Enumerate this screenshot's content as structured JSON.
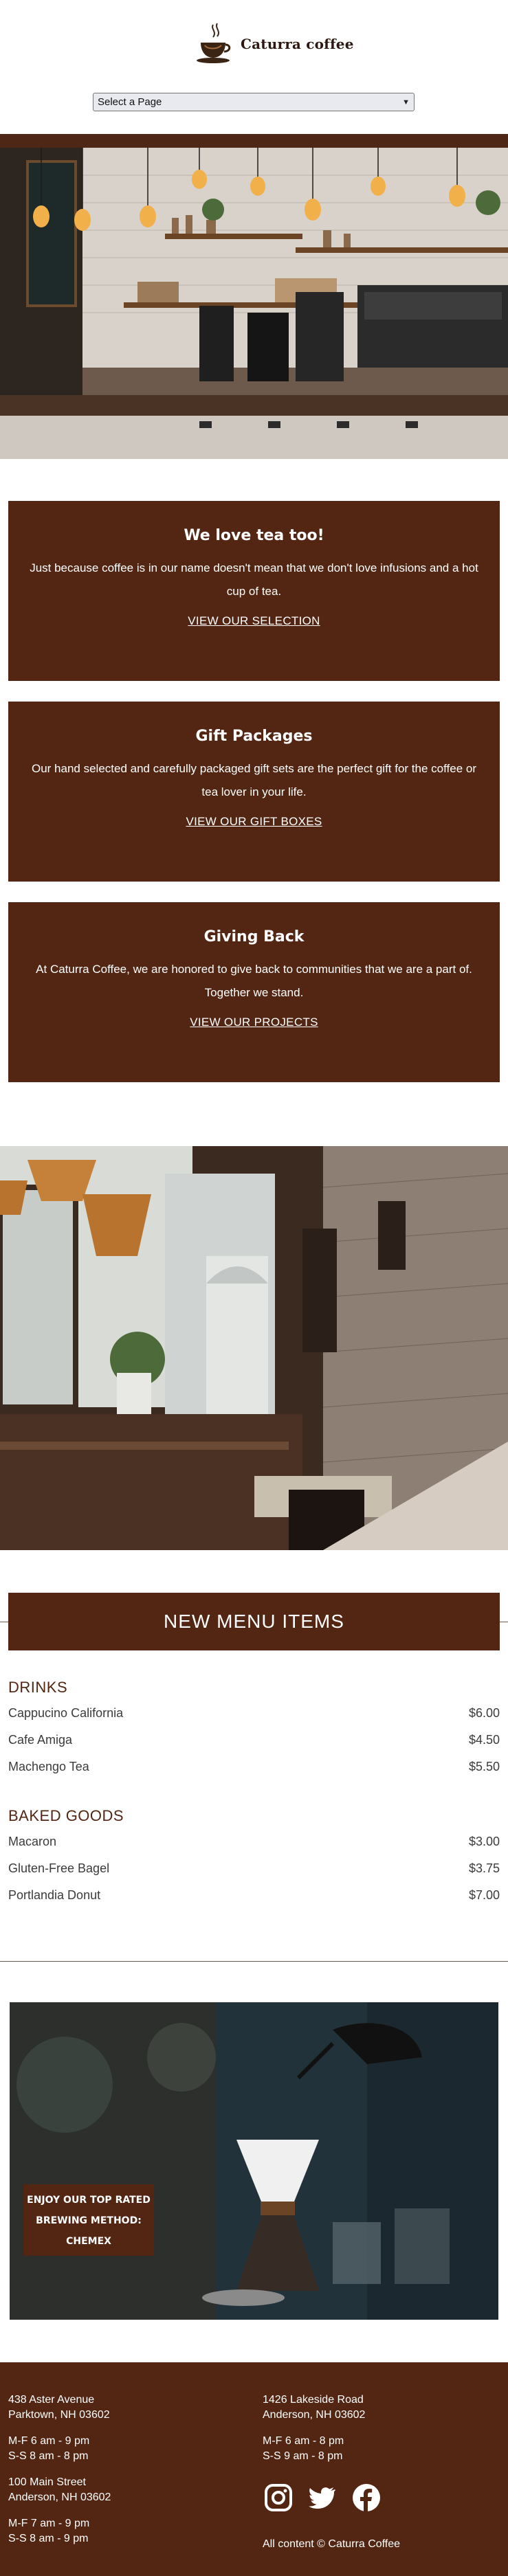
{
  "brand": {
    "name": "Caturra coffee"
  },
  "nav": {
    "select_value": "Select a Page"
  },
  "boxes": [
    {
      "title": "We love tea too!",
      "text": "Just because coffee is in our name doesn't mean that we don't love infusions and a hot cup of tea.",
      "link": "VIEW OUR SELECTION"
    },
    {
      "title": "Gift Packages",
      "text": "Our hand selected and carefully packaged gift sets are the perfect gift for the coffee or tea lover in your life.",
      "link": "VIEW OUR GIFT BOXES"
    },
    {
      "title": "Giving Back",
      "text": "At Caturra Coffee, we are honored to give back to communities that we are a part of. Together we stand.",
      "link": "VIEW OUR PROJECTS"
    }
  ],
  "menu": {
    "title": "NEW MENU ITEMS",
    "sections": [
      {
        "heading": "DRINKS",
        "items": [
          {
            "name": "Cappucino California",
            "price": "$6.00"
          },
          {
            "name": "Cafe Amiga",
            "price": "$4.50"
          },
          {
            "name": "Machengo Tea",
            "price": "$5.50"
          }
        ]
      },
      {
        "heading": "BAKED GOODS",
        "items": [
          {
            "name": "Macaron",
            "price": "$3.00"
          },
          {
            "name": "Gluten-Free Bagel",
            "price": "$3.75"
          },
          {
            "name": "Portlandia Donut",
            "price": "$7.00"
          }
        ]
      }
    ]
  },
  "feature": {
    "line1": "ENJOY OUR TOP RATED",
    "line2": "BREWING METHOD:",
    "line3": "CHEMEX"
  },
  "footer": {
    "left": [
      {
        "line1": "438 Aster Avenue",
        "line2": "Parktown, NH 03602"
      },
      {
        "line1": "M-F 6 am - 9 pm",
        "line2": "S-S 8 am - 8 pm"
      },
      {
        "line1": "100 Main Street",
        "line2": "Anderson, NH 03602"
      },
      {
        "line1": "M-F 7 am - 9 pm",
        "line2": "S-S 8 am - 9 pm"
      }
    ],
    "right": [
      {
        "line1": "1426 Lakeside Road",
        "line2": "Anderson, NH 03602"
      },
      {
        "line1": "M-F 6 am - 8 pm",
        "line2": "S-S 9 am - 8 pm"
      }
    ],
    "copyright": "All content © Caturra Coffee"
  },
  "icons": {
    "social": [
      "instagram-icon",
      "twitter-icon",
      "facebook-icon"
    ]
  },
  "colors": {
    "brand_brown": "#532614",
    "text_dark": "#3b3b3b"
  }
}
